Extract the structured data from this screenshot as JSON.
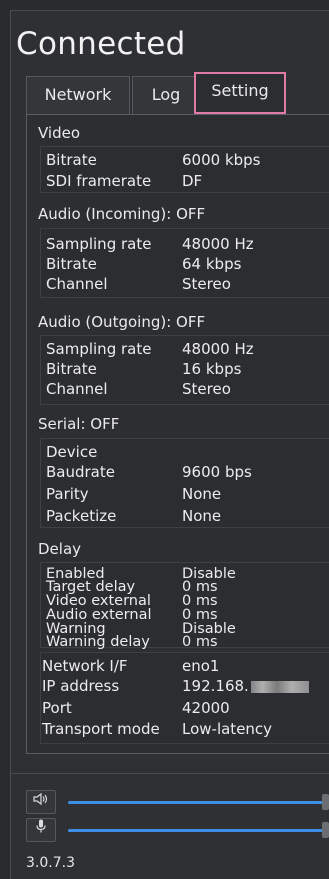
{
  "header": {
    "title": "Connected"
  },
  "tabs": [
    {
      "label": "Network",
      "active": false
    },
    {
      "label": "Log",
      "active": false
    },
    {
      "label": "Setting",
      "active": true
    }
  ],
  "video": {
    "heading": "Video",
    "rows": [
      {
        "label": "Bitrate",
        "value": "6000 kbps"
      },
      {
        "label": "SDI framerate",
        "value": "DF"
      }
    ]
  },
  "audio_in": {
    "heading": "Audio (Incoming): OFF",
    "rows": [
      {
        "label": "Sampling rate",
        "value": "48000 Hz"
      },
      {
        "label": "Bitrate",
        "value": "64 kbps"
      },
      {
        "label": "Channel",
        "value": "Stereo"
      }
    ]
  },
  "audio_out": {
    "heading": "Audio (Outgoing): OFF",
    "rows": [
      {
        "label": "Sampling rate",
        "value": "48000 Hz"
      },
      {
        "label": "Bitrate",
        "value": "16 kbps"
      },
      {
        "label": "Channel",
        "value": "Stereo"
      }
    ]
  },
  "serial": {
    "heading": "Serial: OFF",
    "rows": [
      {
        "label": "Device",
        "value": ""
      },
      {
        "label": "Baudrate",
        "value": "9600 bps"
      },
      {
        "label": "Parity",
        "value": "None"
      },
      {
        "label": "Packetize",
        "value": "None"
      }
    ]
  },
  "delay": {
    "heading": "Delay",
    "rows": [
      {
        "label": "Enabled",
        "value": "Disable"
      },
      {
        "label": "Target delay",
        "value": "0 ms"
      },
      {
        "label": "Video external",
        "value": "0 ms"
      },
      {
        "label": "Audio external",
        "value": "0 ms"
      },
      {
        "label": "Warning",
        "value": "Disable"
      },
      {
        "label": "Warning delay",
        "value": "0 ms"
      }
    ]
  },
  "network": {
    "rows": [
      {
        "label": "Network I/F",
        "value": "eno1"
      },
      {
        "label": "IP address",
        "value": "192.168."
      },
      {
        "label": "Port",
        "value": "42000"
      },
      {
        "label": "Transport mode",
        "value": "Low-latency"
      }
    ]
  },
  "controls": {
    "speaker_icon": "speaker-icon",
    "mic_icon": "microphone-icon",
    "speaker_level": 1.0,
    "mic_level": 1.0
  },
  "footer": {
    "version": "3.0.7.3"
  },
  "colors": {
    "accent": "#3d8ee6",
    "tab_highlight": "#e07aa8",
    "background": "#2e3033"
  }
}
